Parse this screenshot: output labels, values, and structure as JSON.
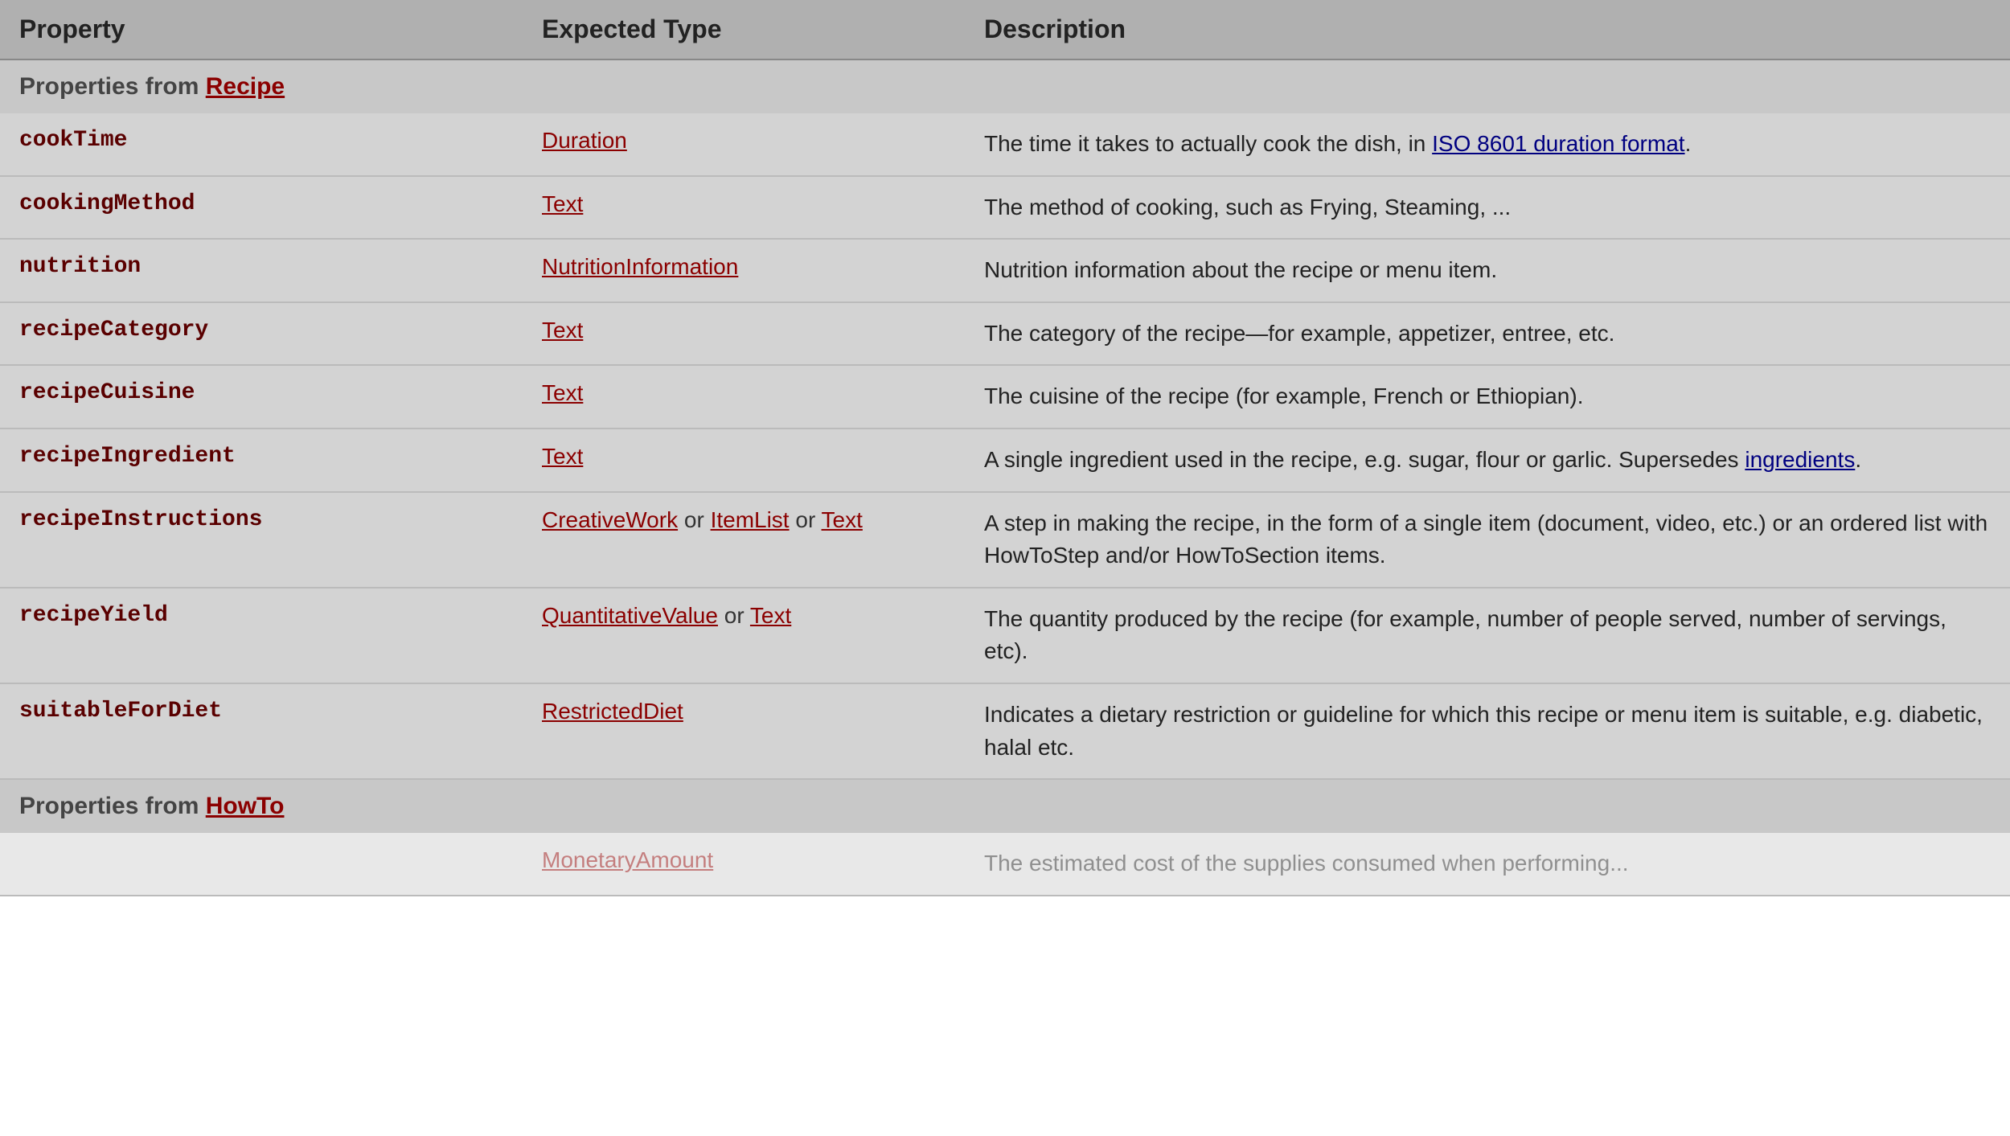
{
  "header": {
    "col1": "Property",
    "col2": "Expected Type",
    "col3": "Description"
  },
  "sections": [
    {
      "title": "Properties from ",
      "titleLink": "Recipe",
      "rows": [
        {
          "property": "cookTime",
          "types": [
            {
              "label": "Duration",
              "link": true
            }
          ],
          "description": "The time it takes to actually cook the dish, in ",
          "descLinks": [
            {
              "text": "ISO 8601 duration format",
              "after": "."
            }
          ]
        },
        {
          "property": "cookingMethod",
          "types": [
            {
              "label": "Text",
              "link": true
            }
          ],
          "description": "The method of cooking, such as Frying, Steaming, ..."
        },
        {
          "property": "nutrition",
          "types": [
            {
              "label": "NutritionInformation",
              "link": true
            }
          ],
          "description": "Nutrition information about the recipe or menu item."
        },
        {
          "property": "recipeCategory",
          "types": [
            {
              "label": "Text",
              "link": true
            }
          ],
          "description": "The category of the recipe—for example, appetizer, entree, etc."
        },
        {
          "property": "recipeCuisine",
          "types": [
            {
              "label": "Text",
              "link": true
            }
          ],
          "description": "The cuisine of the recipe (for example, French or Ethiopian)."
        },
        {
          "property": "recipeIngredient",
          "types": [
            {
              "label": "Text",
              "link": true
            }
          ],
          "description": "A single ingredient used in the recipe, e.g. sugar, flour or garlic. Supersedes ",
          "descLinks": [
            {
              "text": "ingredients",
              "after": "."
            }
          ]
        },
        {
          "property": "recipeInstructions",
          "types": [
            {
              "label": "CreativeWork",
              "link": true
            },
            {
              "label": "or",
              "link": false
            },
            {
              "label": "ItemList",
              "link": true
            },
            {
              "label": "or",
              "link": false
            },
            {
              "label": "Text",
              "link": true
            }
          ],
          "description": "A step in making the recipe, in the form of a single item (document, video, etc.) or an ordered list with HowToStep and/or HowToSection items."
        },
        {
          "property": "recipeYield",
          "types": [
            {
              "label": "QuantitativeValue",
              "link": true
            },
            {
              "label": "or",
              "link": false
            },
            {
              "label": "Text",
              "link": true
            }
          ],
          "description": "The quantity produced by the recipe (for example, number of people served, number of servings, etc)."
        },
        {
          "property": "suitableForDiet",
          "types": [
            {
              "label": "RestrictedDiet",
              "link": true
            }
          ],
          "description": "Indicates a dietary restriction or guideline for which this recipe or menu item is suitable, e.g. diabetic, halal etc."
        }
      ]
    },
    {
      "title": "Properties from ",
      "titleLink": "HowTo",
      "rows": [
        {
          "property": "",
          "types": [
            {
              "label": "MonetaryAmount",
              "link": true
            }
          ],
          "description": "The estimated cost of the supplies consumed when performing...",
          "fade": true
        }
      ]
    }
  ]
}
